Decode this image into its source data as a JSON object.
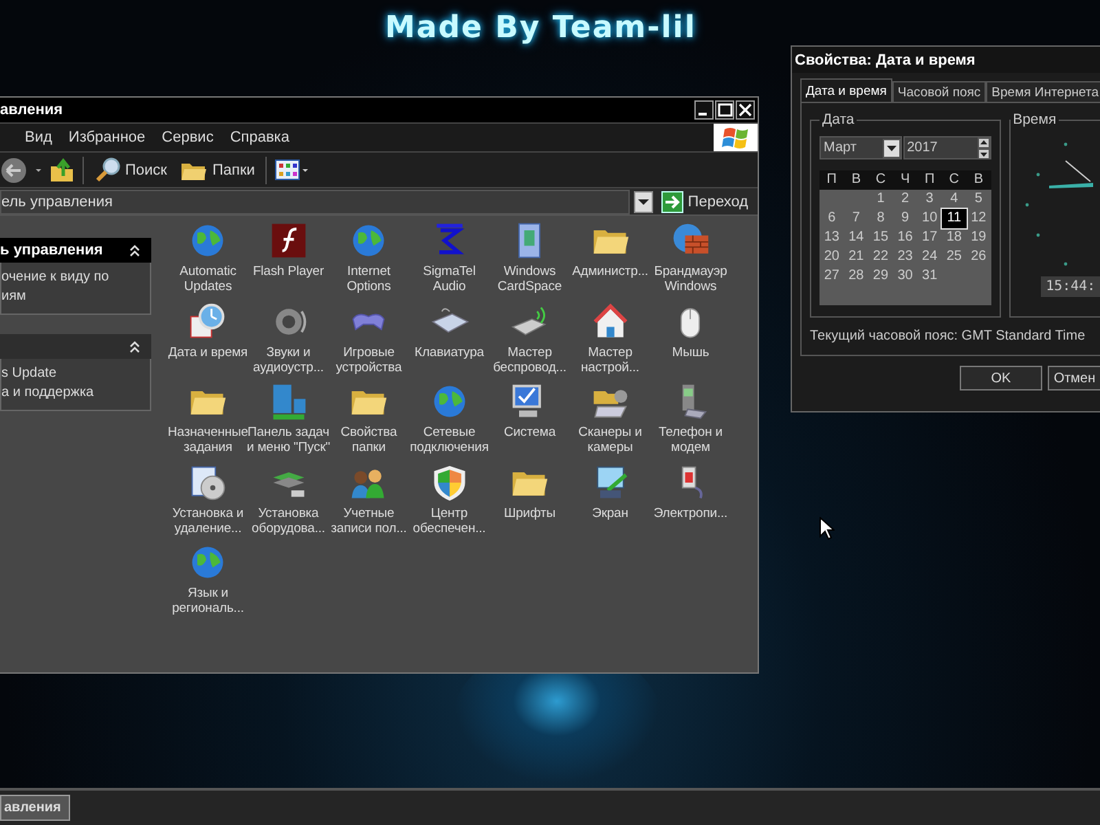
{
  "wallpaper": {
    "caption": "Made By Team-lil"
  },
  "control_panel": {
    "title": "авления",
    "menu": [
      "Вид",
      "Избранное",
      "Сервис",
      "Справка"
    ],
    "toolbar": {
      "search": "Поиск",
      "folders": "Папки"
    },
    "address": {
      "value": "ель управления",
      "go": "Переход"
    },
    "task_panes": [
      {
        "title": "ь управления",
        "expanded": true,
        "links": [
          "очение к виду по",
          "иям"
        ]
      },
      {
        "expanded": true,
        "links": [
          "s Update",
          "а и поддержка"
        ]
      }
    ],
    "items": [
      {
        "lines": [
          "Automatic",
          "Updates"
        ]
      },
      {
        "lines": [
          "Flash Player"
        ]
      },
      {
        "lines": [
          "Internet",
          "Options"
        ]
      },
      {
        "lines": [
          "SigmaTel",
          "Audio"
        ]
      },
      {
        "lines": [
          "Windows",
          "CardSpace"
        ]
      },
      {
        "lines": [
          "Администр..."
        ]
      },
      {
        "lines": [
          "Брандмауэр",
          "Windows"
        ]
      },
      {
        "lines": [
          "Дата и время"
        ]
      },
      {
        "lines": [
          "Звуки и",
          "аудиоустр..."
        ]
      },
      {
        "lines": [
          "Игровые",
          "устройства"
        ]
      },
      {
        "lines": [
          "Клавиатура"
        ]
      },
      {
        "lines": [
          "Мастер",
          "беспровод..."
        ]
      },
      {
        "lines": [
          "Мастер",
          "настрой..."
        ]
      },
      {
        "lines": [
          "Мышь"
        ]
      },
      {
        "lines": [
          "Назначенные",
          "задания"
        ]
      },
      {
        "lines": [
          "Панель задач",
          "и меню \"Пуск\""
        ]
      },
      {
        "lines": [
          "Свойства",
          "папки"
        ]
      },
      {
        "lines": [
          "Сетевые",
          "подключения"
        ]
      },
      {
        "lines": [
          "Система"
        ]
      },
      {
        "lines": [
          "Сканеры и",
          "камеры"
        ]
      },
      {
        "lines": [
          "Телефон и",
          "модем"
        ]
      },
      {
        "lines": [
          "Установка и",
          "удаление..."
        ]
      },
      {
        "lines": [
          "Установка",
          "оборудова..."
        ]
      },
      {
        "lines": [
          "Учетные",
          "записи пол..."
        ]
      },
      {
        "lines": [
          "Центр",
          "обеспечен..."
        ]
      },
      {
        "lines": [
          "Шрифты"
        ]
      },
      {
        "lines": [
          "Экран"
        ]
      },
      {
        "lines": [
          "Электропи..."
        ]
      },
      {
        "lines": [
          "Язык и",
          "региональ..."
        ]
      }
    ]
  },
  "date_time_dialog": {
    "title": "Свойства: Дата и время",
    "tabs": [
      {
        "label": "Дата и время",
        "selected": true
      },
      {
        "label": "Часовой пояс",
        "selected": false
      },
      {
        "label": "Время Интернета",
        "selected": false
      }
    ],
    "date_group": {
      "title": "Дата",
      "month": "Март",
      "year": "2017",
      "weekdays": [
        "П",
        "В",
        "С",
        "Ч",
        "П",
        "С",
        "В"
      ],
      "weeks": [
        [
          {
            "day": "1",
            "selected": false
          },
          {
            "day": "2",
            "selected": false
          },
          {
            "day": "3",
            "selected": false
          },
          {
            "day": "4",
            "selected": false
          },
          {
            "day": "5",
            "selected": false
          }
        ],
        [
          {
            "day": "6",
            "selected": false
          },
          {
            "day": "7",
            "selected": false
          },
          {
            "day": "8",
            "selected": false
          },
          {
            "day": "9",
            "selected": false
          },
          {
            "day": "10",
            "selected": false
          },
          {
            "day": "11",
            "selected": true
          },
          {
            "day": "12",
            "selected": false
          }
        ],
        [
          {
            "day": "13",
            "selected": false
          },
          {
            "day": "14",
            "selected": false
          },
          {
            "day": "15",
            "selected": false
          },
          {
            "day": "16",
            "selected": false
          },
          {
            "day": "17",
            "selected": false
          },
          {
            "day": "18",
            "selected": false
          },
          {
            "day": "19",
            "selected": false
          }
        ],
        [
          {
            "day": "20",
            "selected": false
          },
          {
            "day": "21",
            "selected": false
          },
          {
            "day": "22",
            "selected": false
          },
          {
            "day": "23",
            "selected": false
          },
          {
            "day": "24",
            "selected": false
          },
          {
            "day": "25",
            "selected": false
          },
          {
            "day": "26",
            "selected": false
          }
        ],
        [
          {
            "day": "27",
            "selected": false
          },
          {
            "day": "28",
            "selected": false
          },
          {
            "day": "29",
            "selected": false
          },
          {
            "day": "30",
            "selected": false
          },
          {
            "day": "31",
            "selected": false
          }
        ]
      ]
    },
    "time_group": {
      "title": "Время",
      "time": "15:44:"
    },
    "timezone": "Текущий часовой пояс: GMT Standard Time",
    "buttons": [
      "OK",
      "Отмен"
    ]
  },
  "taskbar": {
    "task_button": "авления"
  }
}
